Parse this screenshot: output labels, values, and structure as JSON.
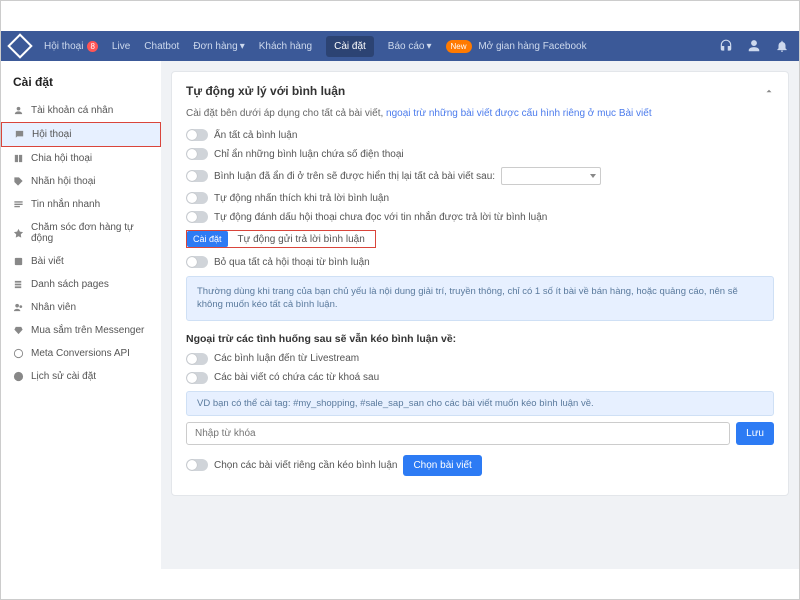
{
  "nav": {
    "items": [
      "Hội thoại",
      "Live",
      "Chatbot",
      "Đơn hàng",
      "Khách hàng",
      "Cài đặt",
      "Báo cáo"
    ],
    "badge": "8",
    "promo_pill": "New",
    "promo_text": "Mở gian hàng Facebook"
  },
  "sidebar": {
    "title": "Cài đặt",
    "items": [
      "Tài khoản cá nhân",
      "Hội thoại",
      "Chia hội thoại",
      "Nhãn hội thoại",
      "Tin nhắn nhanh",
      "Chăm sóc đơn hàng tự động",
      "Bài viết",
      "Danh sách pages",
      "Nhân viên",
      "Mua sắm trên Messenger",
      "Meta Conversions API",
      "Lịch sử cài đặt"
    ]
  },
  "panel": {
    "title": "Tự động xử lý với bình luận",
    "desc_a": "Cài đặt bên dưới áp dụng cho tất cả bài viết, ",
    "desc_b": "ngoại trừ những bài viết được cấu hình riêng ở mục ",
    "desc_c": "Bài viết",
    "opt1": "Ẩn tất cả bình luận",
    "opt2": "Chỉ ẩn những bình luận chứa số điện thoại",
    "opt3": "Bình luận đã ẩn đi ở trên sẽ được hiển thị lại tất cả bài viết sau:",
    "opt4": "Tự động nhấn thích khi trả lời bình luận",
    "opt5": "Tự động đánh dấu hội thoại chưa đọc với tin nhắn được trả lời từ bình luận",
    "hl_btn": "Cài đặt",
    "hl_text": "Tự động gửi trả lời bình luận",
    "opt6": "Bỏ qua tất cả hội thoại từ bình luận",
    "info": "Thường dùng khi trang của bạn chủ yếu là nội dung giải trí, truyền thông, chỉ có 1 số ít bài về bán hàng, hoặc quảng cáo, nên sẽ không muốn kéo tất cả bình luận.",
    "subhead": "Ngoại trừ các tình huống sau sẽ vẫn kéo bình luận về:",
    "ex1": "Các bình luận đến từ Livestream",
    "ex2": "Các bài viết có chứa các từ khoá sau",
    "hint": "VD bạn có thể cài tag: #my_shopping, #sale_sap_san cho các bài viết muốn kéo bình luận về.",
    "input_ph": "Nhập từ khóa",
    "save": "Lưu",
    "opt7": "Chọn các bài viết riêng cần kéo bình luận",
    "choose": "Chọn bài viết"
  }
}
